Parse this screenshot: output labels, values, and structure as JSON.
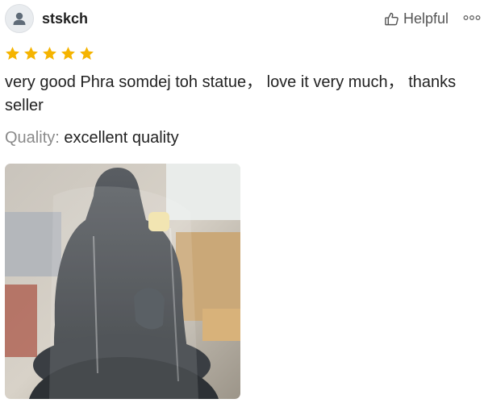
{
  "review": {
    "username": "stskch",
    "helpful_label": "Helpful",
    "rating": 5,
    "rating_max": 5,
    "text": "very good Phra somdej toh statue， love it very much， thanks seller",
    "quality_label": "Quality:",
    "quality_value": "excellent quality",
    "star_color": "#f5b400",
    "icons": {
      "avatar": "user-avatar-icon",
      "helpful": "thumbs-up-icon",
      "more": "more-options-icon",
      "star": "star-icon"
    }
  }
}
